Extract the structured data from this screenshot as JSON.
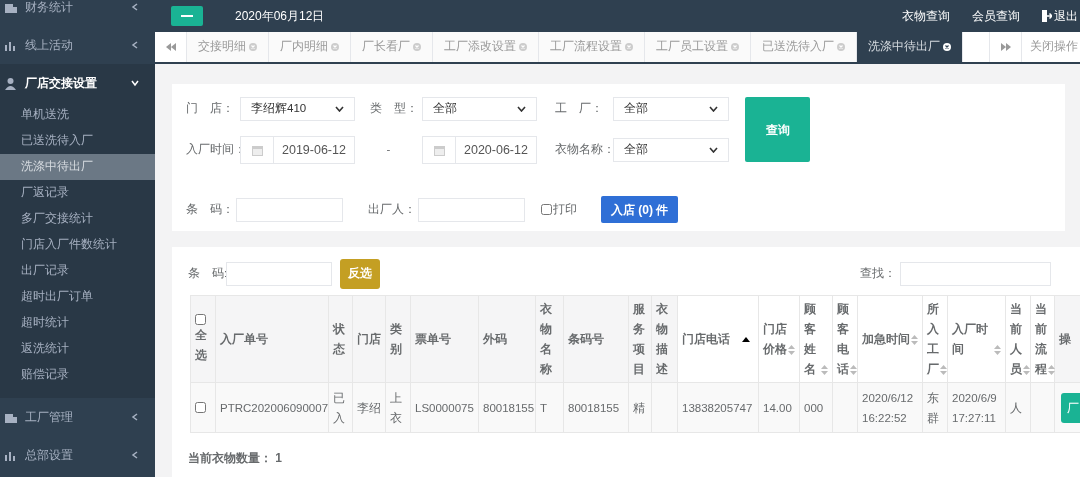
{
  "top_bar": {
    "date": "2020年06月12日",
    "links": [
      {
        "label": "衣物查询",
        "kind": "text"
      },
      {
        "label": "会员查询",
        "kind": "text"
      },
      {
        "label": "退出",
        "kind": "exit"
      }
    ]
  },
  "sidebar": {
    "items": [
      {
        "label": "财务统计",
        "expanded": false
      },
      {
        "label": "线上活动",
        "expanded": false
      },
      {
        "label": "厂店交接设置",
        "expanded": true,
        "children": [
          {
            "label": "单机送洗",
            "selected": false
          },
          {
            "label": "已送洗待入厂",
            "selected": false
          },
          {
            "label": "洗涤中待出厂",
            "selected": true
          },
          {
            "label": "厂返记录",
            "selected": false
          },
          {
            "label": "多厂交接统计",
            "selected": false
          },
          {
            "label": "门店入厂件数统计",
            "selected": false
          },
          {
            "label": "出厂记录",
            "selected": false
          },
          {
            "label": "超时出厂订单",
            "selected": false
          },
          {
            "label": "超时统计",
            "selected": false
          },
          {
            "label": "返洗统计",
            "selected": false
          },
          {
            "label": "赔偿记录",
            "selected": false
          }
        ]
      },
      {
        "label": "工厂管理",
        "expanded": false
      },
      {
        "label": "总部设置",
        "expanded": false
      }
    ]
  },
  "tabs": [
    {
      "label": "交接明细",
      "selected": false
    },
    {
      "label": "厂内明细",
      "selected": false
    },
    {
      "label": "厂长看厂",
      "selected": false
    },
    {
      "label": "工厂添改设置",
      "selected": false
    },
    {
      "label": "工厂流程设置",
      "selected": false
    },
    {
      "label": "工厂员工设置",
      "selected": false
    },
    {
      "label": "已送洗待入厂",
      "selected": false
    },
    {
      "label": "洗涤中待出厂",
      "selected": true
    }
  ],
  "close_ops": "关闭操作",
  "filters": {
    "rows": [
      [
        {
          "label": "门　店：",
          "kind": "select",
          "value": "李绍辉410"
        },
        {
          "label": "类　型：",
          "kind": "select",
          "value": "全部"
        },
        {
          "label": "工　厂：",
          "kind": "select",
          "value": "全部"
        }
      ],
      [
        {
          "label": "入厂时间：",
          "kind": "date",
          "value": "2019-06-12"
        },
        {
          "separator": "-",
          "kind": "date",
          "value": "2020-06-12"
        },
        {
          "label": "衣物名称：",
          "kind": "select",
          "value": "全部"
        }
      ]
    ],
    "query_button": "查询",
    "barcode_label": "条　码：",
    "outer_label": "出厂人：",
    "print": {
      "label": "打印",
      "checked": false
    },
    "in_store_button": "入店 (0) 件"
  },
  "table_panel": {
    "barcode_label": "条　码:",
    "invert_button": "反选",
    "search_label": "查找：",
    "columns": [
      {
        "label": "全选",
        "kind": "checkbox",
        "checked": false,
        "sortable": false,
        "sorted": false
      },
      {
        "label": "入厂单号",
        "sortable": false,
        "sorted": false
      },
      {
        "label": "状态",
        "sortable": false,
        "sorted": false
      },
      {
        "label": "门店",
        "sortable": false,
        "sorted": false
      },
      {
        "label": "类别",
        "sortable": false,
        "sorted": false
      },
      {
        "label": "票单号",
        "sortable": false,
        "sorted": false
      },
      {
        "label": "外码",
        "sortable": false,
        "sorted": false
      },
      {
        "label": "衣物名称",
        "sortable": false,
        "sorted": false
      },
      {
        "label": "条码号",
        "sortable": false,
        "sorted": false
      },
      {
        "label": "服务项目",
        "sortable": false,
        "sorted": false
      },
      {
        "label": "衣物描述",
        "sortable": false,
        "sorted": false
      },
      {
        "label": "门店电话",
        "sortable": true,
        "sorted": true
      },
      {
        "label": "门店价格",
        "sortable": true,
        "sorted": false
      },
      {
        "label": "顾客姓名",
        "sortable": true,
        "sorted": false
      },
      {
        "label": "顾客电话",
        "sortable": true,
        "sorted": false
      },
      {
        "label": "加急时间",
        "sortable": true,
        "sorted": false
      },
      {
        "label": "所入工厂",
        "sortable": true,
        "sorted": false
      },
      {
        "label": "入厂时间",
        "sortable": true,
        "sorted": false
      },
      {
        "label": "当前人员",
        "sortable": true,
        "sorted": false
      },
      {
        "label": "当前流程",
        "sortable": true,
        "sorted": false
      },
      {
        "label": "操",
        "sortable": false,
        "sorted": false
      }
    ],
    "rows": [
      {
        "checked": false,
        "cells": [
          "",
          "PTRC202006090007",
          "已入",
          "李绍",
          "上衣",
          "LS0000075",
          "80018155",
          "T",
          "80018155",
          "精",
          "",
          "13838205747",
          "14.00",
          "000",
          "",
          "2020/6/12 16:22:52",
          "东群",
          "2020/6/9 17:27:11",
          "人",
          "",
          "厂"
        ]
      }
    ],
    "footer": "当前衣物数量： 1"
  }
}
